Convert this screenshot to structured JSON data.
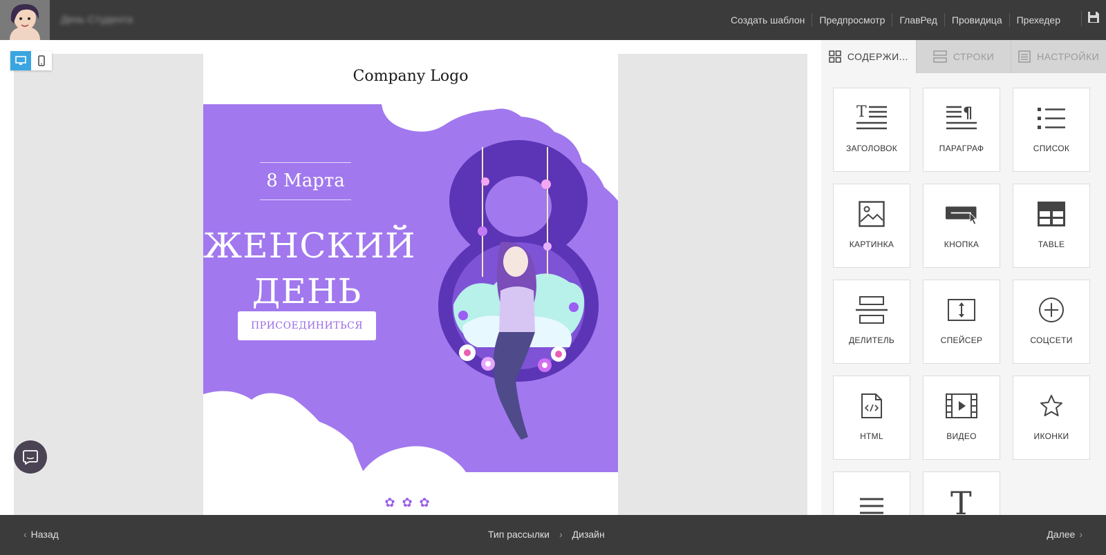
{
  "header": {
    "document_title": "День Студента",
    "nav": [
      "Создать шаблон",
      "Предпросмотр",
      "ГлавРед",
      "Провидица",
      "Прехедер"
    ],
    "save_icon": "floppy-disk-icon"
  },
  "device_toggle": {
    "options": [
      {
        "name": "desktop",
        "icon": "desktop-icon",
        "active": true
      },
      {
        "name": "mobile",
        "icon": "mobile-icon",
        "active": false
      }
    ],
    "active_color": "#3aa5e0"
  },
  "email": {
    "logo_text": "Company Logo",
    "hero": {
      "date": "8 Марта",
      "title_line1": "ЖЕНСКИЙ",
      "title_line2": "ДЕНЬ",
      "button": "ПРИСОЕДИНИТЬСЯ",
      "background": "#a178ee",
      "big_digit": "8"
    },
    "footer_flowers": "✿✿✿"
  },
  "panel": {
    "tabs": [
      {
        "label": "СОДЕРЖИ...",
        "icon": "grid-icon",
        "active": true
      },
      {
        "label": "СТРОКИ",
        "icon": "rows-icon",
        "active": false
      },
      {
        "label": "НАСТРОЙКИ",
        "icon": "settings-doc-icon",
        "active": false
      }
    ],
    "blocks": [
      {
        "label": "ЗАГОЛОВОК",
        "icon": "heading-icon"
      },
      {
        "label": "ПАРАГРАФ",
        "icon": "paragraph-icon"
      },
      {
        "label": "СПИСОК",
        "icon": "list-icon"
      },
      {
        "label": "КАРТИНКА",
        "icon": "image-icon"
      },
      {
        "label": "КНОПКА",
        "icon": "button-icon"
      },
      {
        "label": "TABLE",
        "icon": "table-icon"
      },
      {
        "label": "ДЕЛИТЕЛЬ",
        "icon": "divider-icon"
      },
      {
        "label": "СПЕЙСЕР",
        "icon": "spacer-icon"
      },
      {
        "label": "СОЦСЕТИ",
        "icon": "social-icon"
      },
      {
        "label": "HTML",
        "icon": "html-icon"
      },
      {
        "label": "ВИДЕО",
        "icon": "video-icon"
      },
      {
        "label": "ИКОНКИ",
        "icon": "star-icon"
      },
      {
        "label": "",
        "icon": "menu-icon"
      },
      {
        "label": "",
        "icon": "text-icon"
      }
    ]
  },
  "footer": {
    "back": "Назад",
    "steps": [
      "Тип рассылки",
      "Дизайн"
    ],
    "next": "Далее"
  },
  "chat": {
    "icon": "chat-icon"
  }
}
